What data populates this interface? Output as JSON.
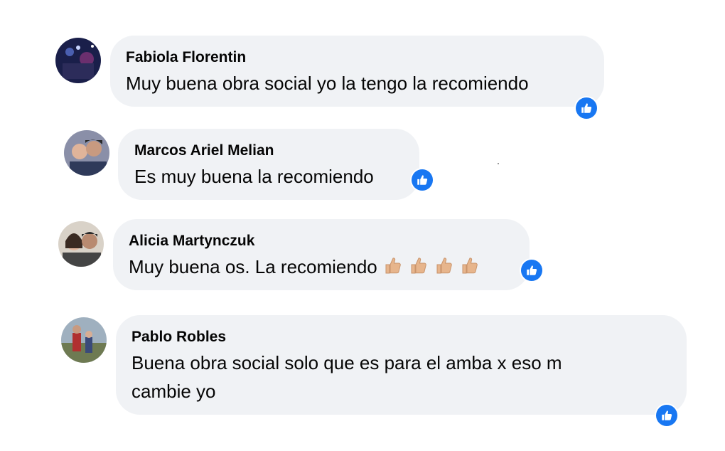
{
  "comments": [
    {
      "author": "Fabiola Florentin",
      "text": "Muy buena obra social yo la tengo la recomiendo",
      "reaction_icon": "like-icon"
    },
    {
      "author": "Marcos Ariel Melian",
      "text": "Es muy buena la recomiendo",
      "reaction_icon": "like-icon"
    },
    {
      "author": "Alicia Martynczuk",
      "text": "Muy buena os. La recomiendo",
      "emoji": "👍🏼👍🏼👍🏼👍🏼",
      "reaction_icon": "like-icon"
    },
    {
      "author": "Pablo Robles",
      "text_line1": "Buena obra social solo que es para el amba x eso m",
      "text_line2": "cambie yo",
      "reaction_icon": "like-icon"
    }
  ],
  "colors": {
    "bubble": "#f0f2f5",
    "like_blue": "#1877f2",
    "thumb_skin": "#e7b58c"
  }
}
